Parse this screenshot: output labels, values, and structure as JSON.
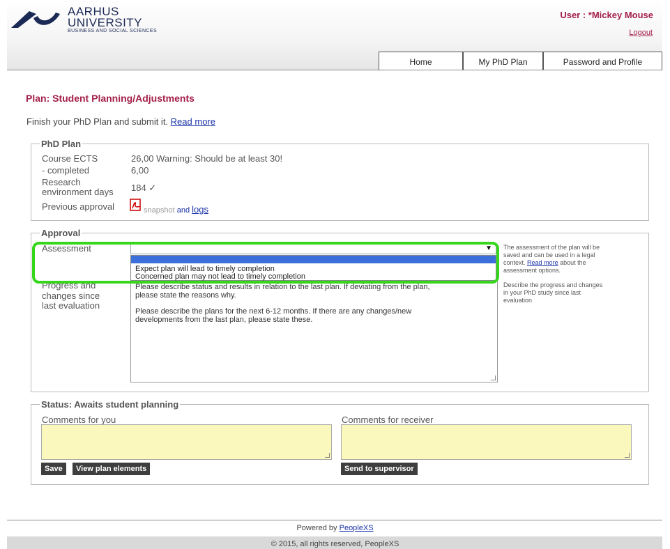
{
  "header": {
    "logo_line1": "AARHUS",
    "logo_line2": "UNIVERSITY",
    "logo_line3": "BUSINESS AND SOCIAL SCIENCES",
    "user_label": "User : *Mickey Mouse",
    "logout_label": "Logout"
  },
  "tabs": [
    {
      "label": "Home",
      "active": true
    },
    {
      "label": "My PhD Plan",
      "active": false
    },
    {
      "label": "Password and Profile",
      "active": false
    }
  ],
  "page": {
    "heading": "Plan: Student Planning/Adjustments",
    "intro_text": "Finish your PhD Plan and submit it.",
    "intro_link": "Read more"
  },
  "phd_plan": {
    "legend": "PhD Plan",
    "course_ects_label": "Course ECTS",
    "course_ects_value": "26,00 Warning: Should be at least 30!",
    "completed_label": "- completed",
    "completed_value": "6,00",
    "research_label_1": "Research",
    "research_label_2": "environment days",
    "research_value": "184 ✓",
    "previous_approval_label": "Previous approval",
    "snapshot_label": "snapshot",
    "and_label": "and",
    "logs_label": "logs"
  },
  "approval": {
    "legend": "Approval",
    "assessment_label": "Assessment",
    "assessment_value": "",
    "options": [
      "Expect plan will lead to timely completion",
      "Concerned plan may not lead to timely completion"
    ],
    "assessment_help_1": "The assessment of the plan will be",
    "assessment_help_2": "saved and can be used in a legal",
    "assessment_help_3a": "context.",
    "assessment_help_link": "Read more",
    "assessment_help_3b": "about the",
    "assessment_help_4": "assessment options.",
    "progress_label_1": "Progress and",
    "progress_label_2": "changes since",
    "progress_label_3": "last evaluation",
    "progress_text_1": "Please describe status and results in relation to the last plan. If deviating from the plan,",
    "progress_text_2": "please state the reasons why.",
    "progress_text_3": "Please describe the plans for the next 6-12 months. If there are any changes/new",
    "progress_text_4": "developments from the last plan, please state these.",
    "progress_help_1": "Describe the progress and changes",
    "progress_help_2": "in your PhD study since last",
    "progress_help_3": "evaluation"
  },
  "status": {
    "legend": "Status: Awaits student planning",
    "comments_you_label": "Comments for you",
    "comments_receiver_label": "Comments for receiver",
    "save_label": "Save",
    "view_elements_label": "View plan elements",
    "send_label": "Send to supervisor"
  },
  "footer": {
    "powered_by": "Powered by",
    "powered_link": "PeopleXS",
    "copyright": "© 2015, all rights reserved, PeopleXS"
  },
  "colors": {
    "accent": "#a31e48",
    "link": "#1a33a8",
    "highlight_green": "#35d61c",
    "comment_bg": "#fbf8bd",
    "button_bg": "#3e3e3e",
    "select_highlight": "#3b6fd9"
  },
  "icons": {
    "logo": "aarhus-university-logo",
    "pdf": "pdf-icon",
    "dropdown": "dropdown-arrow-icon",
    "resize": "resize-handle-icon"
  }
}
